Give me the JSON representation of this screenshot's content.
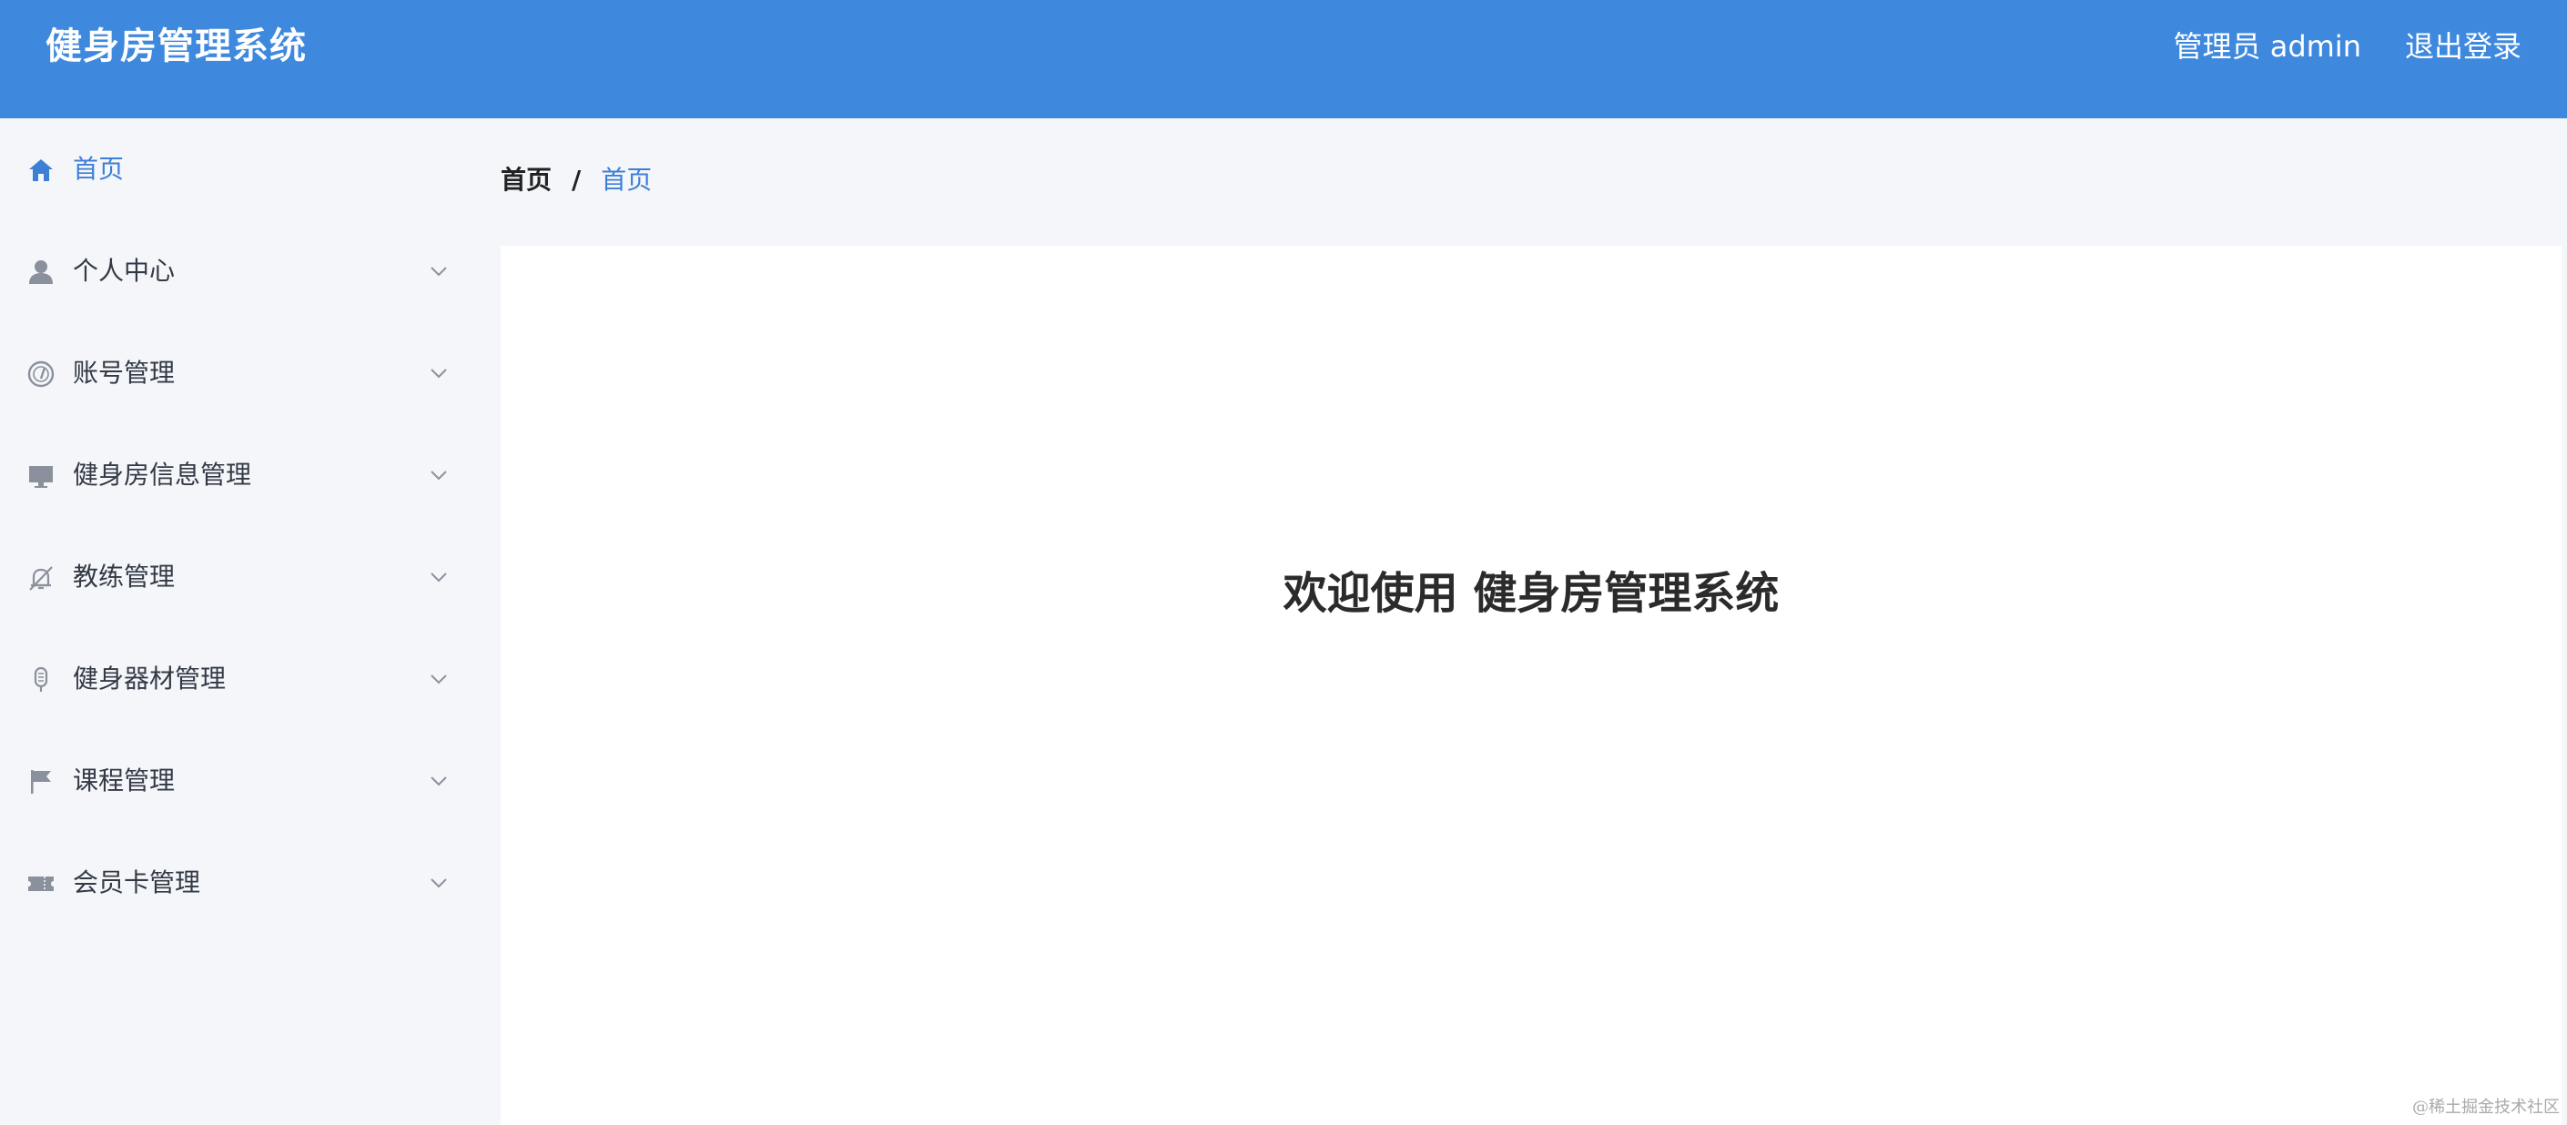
{
  "header": {
    "app_title": "健身房管理系统",
    "user_label": "管理员 admin",
    "logout_label": "退出登录"
  },
  "sidebar": {
    "items": [
      {
        "label": "首页",
        "icon": "home-icon",
        "active": true
      },
      {
        "label": "个人中心",
        "icon": "user-icon",
        "expandable": true
      },
      {
        "label": "账号管理",
        "icon": "gauge-icon",
        "expandable": true
      },
      {
        "label": "健身房信息管理",
        "icon": "monitor-icon",
        "expandable": true
      },
      {
        "label": "教练管理",
        "icon": "bell-off-icon",
        "expandable": true
      },
      {
        "label": "健身器材管理",
        "icon": "microphone-icon",
        "expandable": true
      },
      {
        "label": "课程管理",
        "icon": "flag-icon",
        "expandable": true
      },
      {
        "label": "会员卡管理",
        "icon": "ticket-icon",
        "expandable": true
      }
    ]
  },
  "breadcrumb": {
    "home": "首页",
    "separator": "/",
    "current": "首页"
  },
  "main": {
    "welcome_text": "欢迎使用 健身房管理系统"
  },
  "watermark": "@稀土掘金技术社区",
  "colors": {
    "header_bg": "#3e89de",
    "accent": "#3e7fd6",
    "sidebar_bg": "#f4f6fa",
    "icon_gray": "#8a919c"
  }
}
